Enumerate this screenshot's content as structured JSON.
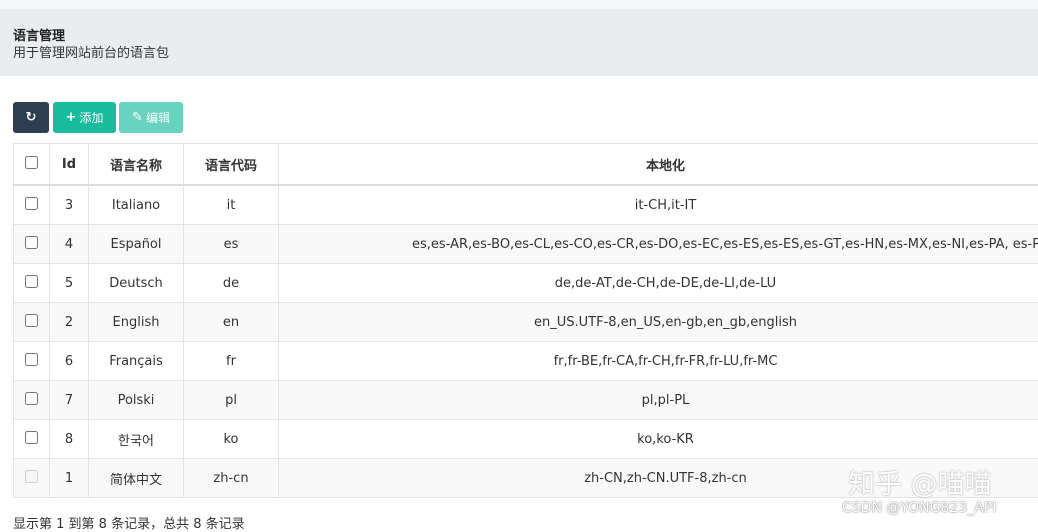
{
  "header": {
    "title": "语言管理",
    "subtitle": "用于管理网站前台的语言包"
  },
  "toolbar": {
    "refresh_icon": "↻",
    "add_label": "添加",
    "add_icon": "+",
    "edit_label": "编辑",
    "edit_icon": "✎"
  },
  "table": {
    "columns": [
      "Id",
      "语言名称",
      "语言代码",
      "本地化"
    ],
    "rows": [
      {
        "id": "3",
        "name": "Italiano",
        "code": "it",
        "locale": "it-CH,it-IT"
      },
      {
        "id": "4",
        "name": "Español",
        "code": "es",
        "locale": "es,es-AR,es-BO,es-CL,es-CO,es-CR,es-DO,es-EC,es-ES,es-ES,es-GT,es-HN,es-MX,es-NI,es-PA, es-PE,es-PR,es-PY,es-SV,es-US,es-UY,es-VE"
      },
      {
        "id": "5",
        "name": "Deutsch",
        "code": "de",
        "locale": "de,de-AT,de-CH,de-DE,de-LI,de-LU"
      },
      {
        "id": "2",
        "name": "English",
        "code": "en",
        "locale": "en_US.UTF-8,en_US,en-gb,en_gb,english"
      },
      {
        "id": "6",
        "name": "Français",
        "code": "fr",
        "locale": "fr,fr-BE,fr-CA,fr-CH,fr-FR,fr-LU,fr-MC"
      },
      {
        "id": "7",
        "name": "Polski",
        "code": "pl",
        "locale": "pl,pl-PL"
      },
      {
        "id": "8",
        "name": "한국어",
        "code": "ko",
        "locale": "ko,ko-KR"
      },
      {
        "id": "1",
        "name": "简体中文",
        "code": "zh-cn",
        "locale": "zh-CN,zh-CN.UTF-8,zh-cn"
      }
    ]
  },
  "footer": {
    "summary": "显示第 1 到第 8 条记录，总共 8 条记录"
  },
  "watermark": {
    "line1": "知乎 @喵喵",
    "line2": "CSDN @YONG823_API"
  },
  "colors": {
    "primary": "#2c3e50",
    "success": "#18bc9c",
    "header_bg": "#e9edf0"
  }
}
